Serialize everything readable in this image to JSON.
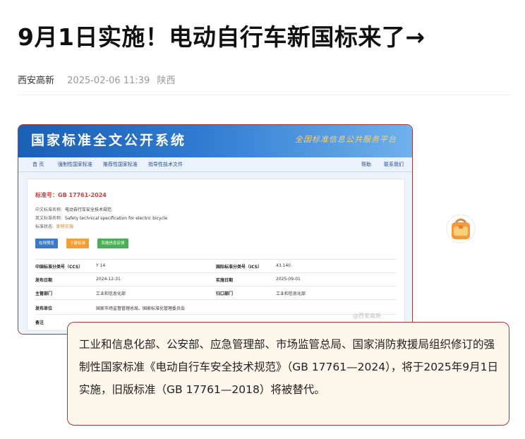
{
  "article": {
    "title": "9月1日实施！电动自行车新国标来了→",
    "author": "西安高新",
    "date": "2025-02-06 11:39",
    "location": "陕西"
  },
  "screenshot": {
    "site_title": "国家标准全文公开系统",
    "slogan": "全国标准信息公共服务平台",
    "nav": [
      "首 页",
      "强制性国家标准",
      "推荐性国家标准",
      "指导性技术文件",
      "帮助",
      "联系我们"
    ],
    "standard_no": "标准号：GB 17761-2024",
    "cn_name_label": "中文标准名称:",
    "cn_name": "电动自行车安全技术规范",
    "en_name_label": "英文标准名称:",
    "en_name": "Safety technical specification for electric bicycle",
    "status_label": "标准状态:",
    "status": "即将实施",
    "buttons": [
      "在线预览",
      "下载标准",
      "实施信息反馈"
    ],
    "table": {
      "ccs_label": "中国标准分类号（CCS）",
      "ccs": "Y 14",
      "ics_label": "国际标准分类号（ICS）",
      "ics": "43.140",
      "pub_label": "发布日期",
      "pub": "2024-12-31",
      "impl_label": "实施日期",
      "impl": "2025-09-01",
      "dept_label": "主管部门",
      "dept": "工业和信息化部",
      "gui_label": "归口部门",
      "gui": "工业和信息化部",
      "issuer_label": "发布单位",
      "issuer": "国家市场监督管理总局、国家标准化管理委员会",
      "note_label": "备注"
    },
    "watermark": "@西安高新"
  },
  "caption": "工业和信息化部、公安部、应急管理部、市场监管总局、国家消防救援局组织修订的强制性国家标准《电动自行车安全技术规范》（GB 17761—2024），将于2025年9月1日实施，旧版标准（GB 17761—2018）将被替代。",
  "icons": {
    "sticker": "schoolbag-icon"
  }
}
